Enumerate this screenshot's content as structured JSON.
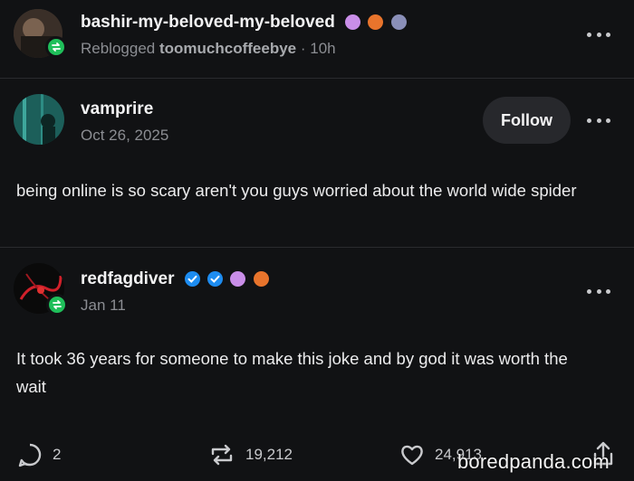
{
  "reblog": {
    "username": "bashir-my-beloved-my-beloved",
    "reblogged_prefix": "Reblogged",
    "reblogged_from": "toomuchcoffeebye",
    "time": "· 10h"
  },
  "post": {
    "username": "vamprire",
    "date": "Oct 26, 2025",
    "follow_label": "Follow",
    "text": "being online is so scary aren't you guys worried about the world wide spider"
  },
  "reply": {
    "username": "redfagdiver",
    "date": "Jan 11",
    "text": "It took 36 years for someone to make this joke and by god it was worth the wait"
  },
  "footer": {
    "comments": "2",
    "reblogs": "19,212",
    "likes": "24,913"
  },
  "watermark": "boredpanda.com",
  "colors": {
    "background": "#111214",
    "reblog_green": "#1fbf5a",
    "verified_blue": "#1d8cf0",
    "badge_purple": "#c98ee8",
    "badge_orange": "#e8742c"
  }
}
